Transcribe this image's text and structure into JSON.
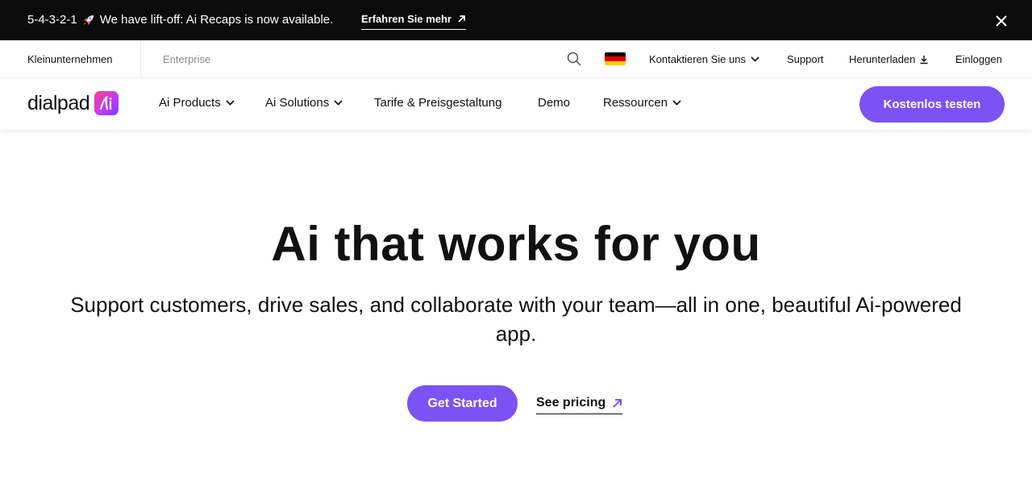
{
  "announcement": {
    "countdown": "5-4-3-2-1",
    "rocket_icon": "rocket-icon",
    "message": "We have lift-off: Ai Recaps is now available.",
    "cta_label": "Erfahren Sie mehr",
    "close_icon": "close-icon"
  },
  "utility_bar": {
    "segment_small_business": "Kleinunternehmen",
    "segment_enterprise": "Enterprise",
    "search_icon": "search-icon",
    "flag_icon": "germany-flag-icon",
    "contact_label": "Kontaktieren Sie uns",
    "support_label": "Support",
    "download_label": "Herunterladen",
    "login_label": "Einloggen"
  },
  "main_nav": {
    "logo_text": "dialpad",
    "logo_badge": "Ai",
    "items": [
      {
        "label": "Ai Products",
        "has_dropdown": true
      },
      {
        "label": "Ai Solutions",
        "has_dropdown": true
      },
      {
        "label": "Tarife & Preisgestaltung",
        "has_dropdown": false
      },
      {
        "label": "Demo",
        "has_dropdown": false
      },
      {
        "label": "Ressourcen",
        "has_dropdown": true
      }
    ],
    "trial_button": "Kostenlos testen"
  },
  "hero": {
    "title": "Ai that works for you",
    "subtitle": "Support customers, drive sales, and collaborate with your team—all in one, beautiful Ai-powered app.",
    "primary_cta": "Get Started",
    "secondary_cta": "See pricing"
  },
  "colors": {
    "accent": "#7c52f4",
    "announcement_bg": "#0b0b0b"
  }
}
